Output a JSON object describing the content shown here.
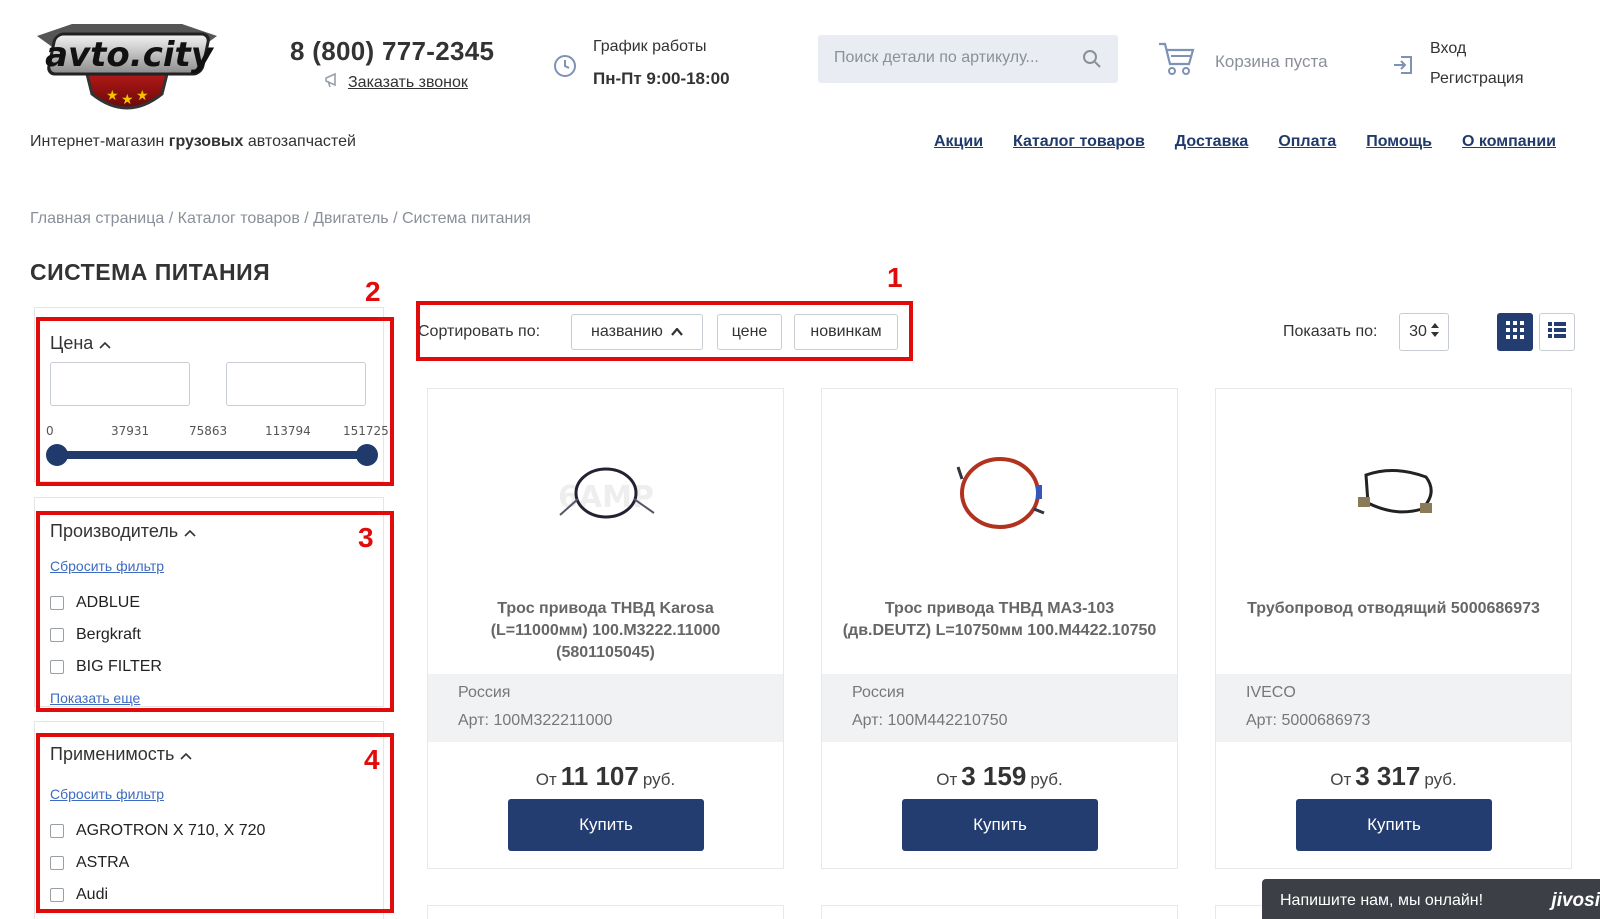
{
  "header": {
    "logo_text": "avto.city",
    "tagline": {
      "pre": "Интернет-магазин ",
      "bold": "грузовых",
      "post": " автозапчастей"
    },
    "phone": "8 (800) 777-2345",
    "callback_label": "Заказать звонок",
    "schedule_label": "График работы",
    "schedule_hours": "Пн-Пт 9:00-18:00",
    "search_placeholder": "Поиск детали по артикулу...",
    "cart_label": "Корзина пуста",
    "login_label": "Вход",
    "register_label": "Регистрация"
  },
  "nav": [
    "Акции",
    "Каталог товаров",
    "Доставка",
    "Оплата",
    "Помощь",
    "О компании"
  ],
  "breadcrumb": "Главная страница / Каталог товаров / Двигатель / Система питания",
  "page_title": "СИСТЕМА ПИТАНИЯ",
  "annotations": [
    "1",
    "2",
    "3",
    "4"
  ],
  "filters": {
    "price": {
      "title": "Цена",
      "min_value": "",
      "max_value": "",
      "ticks": [
        "0",
        "37931",
        "75863",
        "113794",
        "151725"
      ],
      "range_low": 0,
      "range_high": 151725
    },
    "manufacturer": {
      "title": "Производитель",
      "reset": "Сбросить фильтр",
      "options": [
        "ADBLUE",
        "Bergkraft",
        "BIG FILTER"
      ],
      "more": "Показать еще"
    },
    "applicability": {
      "title": "Применимость",
      "reset": "Сбросить фильтр",
      "options": [
        "AGROTRON X 710, X 720",
        "ASTRA",
        "Audi"
      ]
    }
  },
  "sort": {
    "label": "Сортировать по:",
    "options": [
      "названию",
      "цене",
      "новинкам"
    ],
    "show_label": "Показать по:",
    "show_value": "30"
  },
  "products": [
    {
      "name": "Трос привода ТНВД Karosa (L=11000мм) 100.M3222.11000 (5801105045)",
      "country": "Россия",
      "article": "Арт: 100M322211000",
      "price_prefix": "От",
      "price": "11 107",
      "currency": "руб.",
      "buy": "Купить"
    },
    {
      "name": "Трос привода ТНВД МАЗ-103 (дв.DEUTZ) L=10750мм 100.M4422.10750",
      "country": "Россия",
      "article": "Арт: 100M442210750",
      "price_prefix": "От",
      "price": "3 159",
      "currency": "руб.",
      "buy": "Купить"
    },
    {
      "name": "Трубопровод отводящий 5000686973",
      "country": "IVECO",
      "article": "Арт: 5000686973",
      "price_prefix": "От",
      "price": "3 317",
      "currency": "руб.",
      "buy": "Купить"
    }
  ],
  "chat": {
    "label": "Напишите нам, мы онлайн!",
    "brand": "jivosi"
  },
  "colors": {
    "primary": "#233d70",
    "link": "#3d6bc1",
    "annotation": "#e10b0b"
  }
}
